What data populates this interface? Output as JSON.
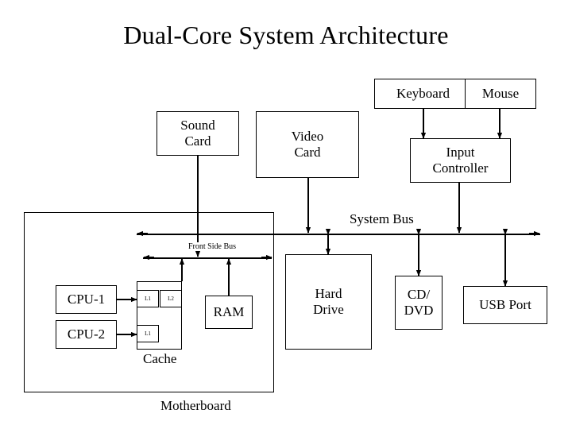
{
  "title": "Dual-Core System Architecture",
  "boxes": {
    "keyboard": "Keyboard",
    "mouse": "Mouse",
    "sound_card": "Sound\nCard",
    "sound_card_l1": "Sound",
    "sound_card_l2": "Card",
    "video_card_l1": "Video",
    "video_card_l2": "Card",
    "input_controller_l1": "Input",
    "input_controller_l2": "Controller",
    "cpu1": "CPU-1",
    "cpu2": "CPU-2",
    "ram": "RAM",
    "hard_drive_l1": "Hard",
    "hard_drive_l2": "Drive",
    "cd_dvd_l1": "CD/",
    "cd_dvd_l2": "DVD",
    "usb_port": "USB Port"
  },
  "labels": {
    "system_bus": "System Bus",
    "front_side_bus": "Front Side Bus",
    "cache": "Cache",
    "motherboard": "Motherboard"
  },
  "cache_slots": {
    "cpu1_l1": "L1",
    "cpu1_l2": "L2",
    "cpu2_l1": "L1"
  },
  "colors": {
    "stroke": "#000000",
    "background": "#ffffff",
    "text": "#000000"
  },
  "diagram_structure": {
    "type": "block-diagram",
    "connections": [
      {
        "from": "keyboard",
        "to": "input_controller",
        "arrow": "both"
      },
      {
        "from": "mouse",
        "to": "input_controller",
        "arrow": "both"
      },
      {
        "from": "input_controller",
        "to": "system_bus",
        "arrow": "both"
      },
      {
        "from": "sound_card",
        "to": "front_side_bus",
        "arrow": "both"
      },
      {
        "from": "video_card",
        "to": "system_bus",
        "arrow": "both"
      },
      {
        "from": "system_bus",
        "to": "hard_drive",
        "arrow": "both"
      },
      {
        "from": "system_bus",
        "to": "cd_dvd",
        "arrow": "both"
      },
      {
        "from": "system_bus",
        "to": "usb_port",
        "arrow": "both"
      },
      {
        "from": "cpu1",
        "to": "cache",
        "arrow": "both"
      },
      {
        "from": "cache",
        "to": "front_side_bus",
        "arrow": "both"
      },
      {
        "from": "ram",
        "to": "front_side_bus",
        "arrow": "both"
      }
    ]
  }
}
